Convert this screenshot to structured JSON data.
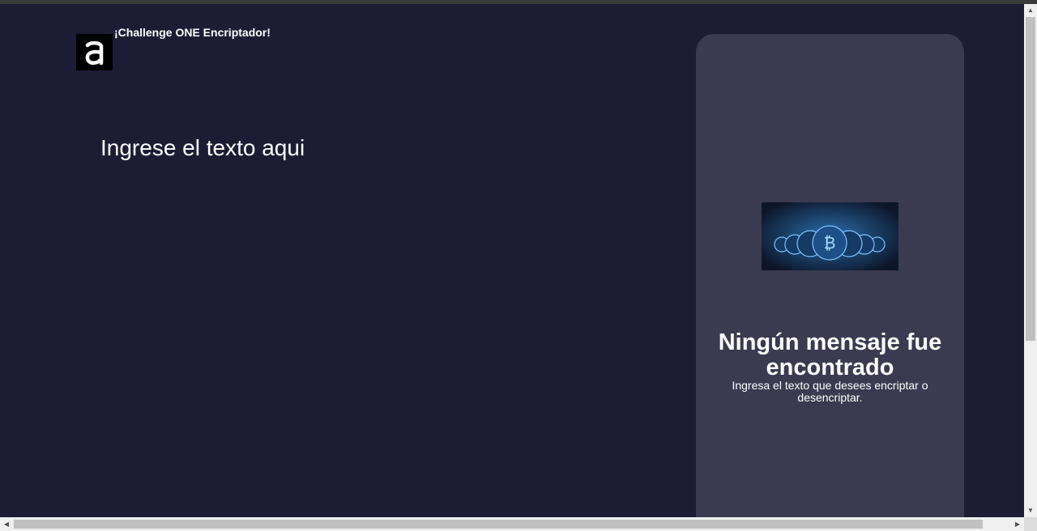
{
  "header": {
    "logo_icon": "alura-logo-icon",
    "title": "¡Challenge ONE Encriptador!"
  },
  "input": {
    "placeholder": "Ingrese el texto aqui",
    "value": ""
  },
  "output_panel": {
    "image_icon": "crypto-coins-image",
    "title": "Ningún mensaje fue encontrado",
    "subtitle": "Ingresa el texto que desees encriptar o desencriptar."
  },
  "colors": {
    "background": "#1c1d35",
    "panel": "#3a3b50",
    "text": "#ffffff"
  }
}
